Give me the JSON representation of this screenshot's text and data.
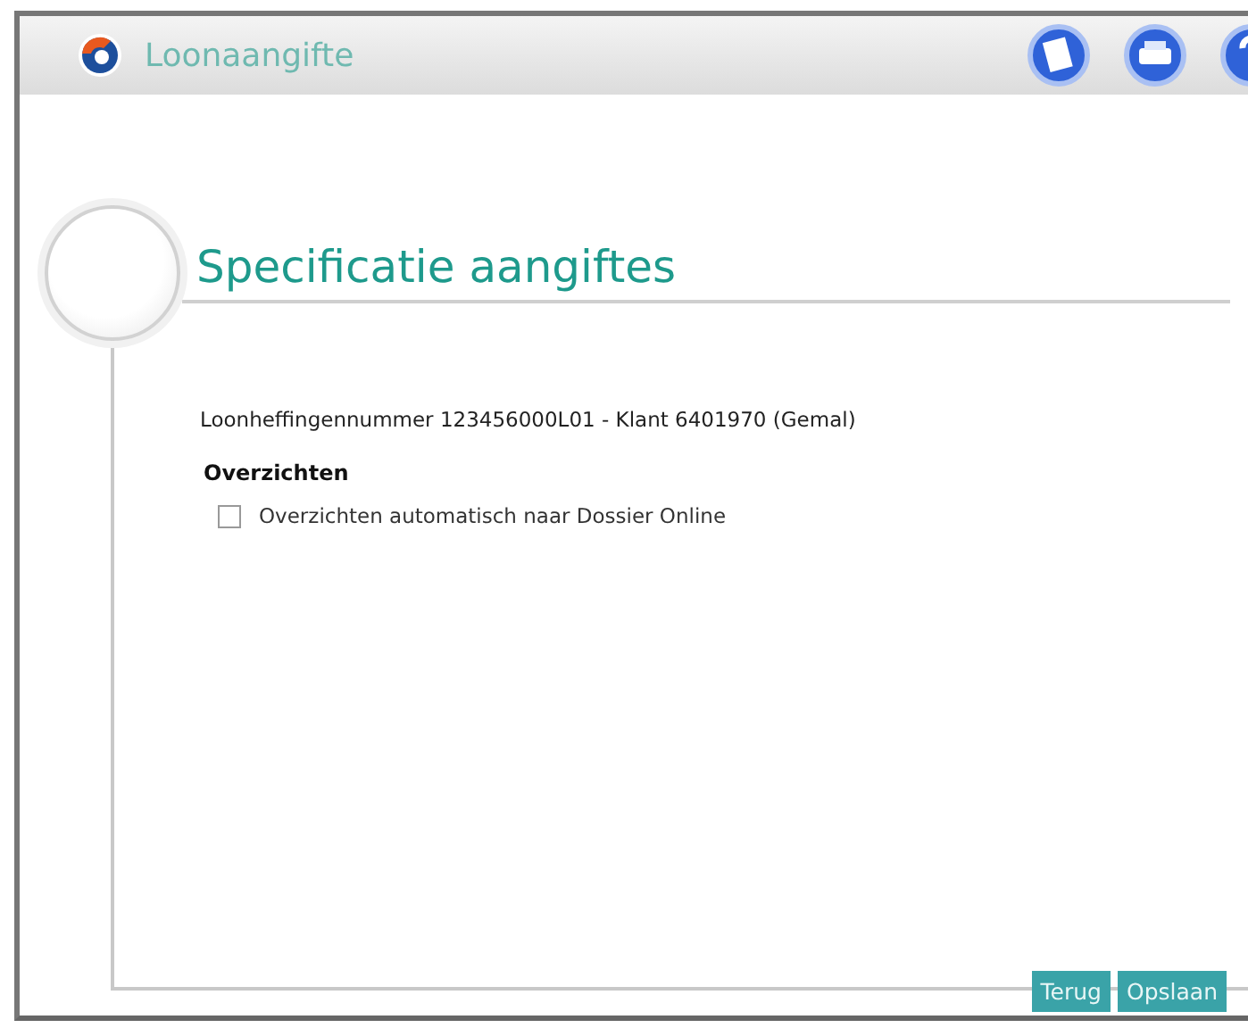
{
  "window": {
    "title": "Loonaangifte"
  },
  "toolbar": [
    {
      "kind": "notes"
    },
    {
      "kind": "print"
    },
    {
      "kind": "help"
    }
  ],
  "page": {
    "heading": "Specificatie aangiftes",
    "subtitle": "Loonheffingennummer 123456000L01 - Klant 6401970 (Gemal)",
    "section": {
      "title": "Overzichten",
      "options": [
        {
          "label": "Overzichten automatisch naar Dossier Online",
          "checked": false
        }
      ]
    }
  },
  "buttons": [
    {
      "label": "Terug"
    },
    {
      "label": "Opslaan"
    }
  ]
}
